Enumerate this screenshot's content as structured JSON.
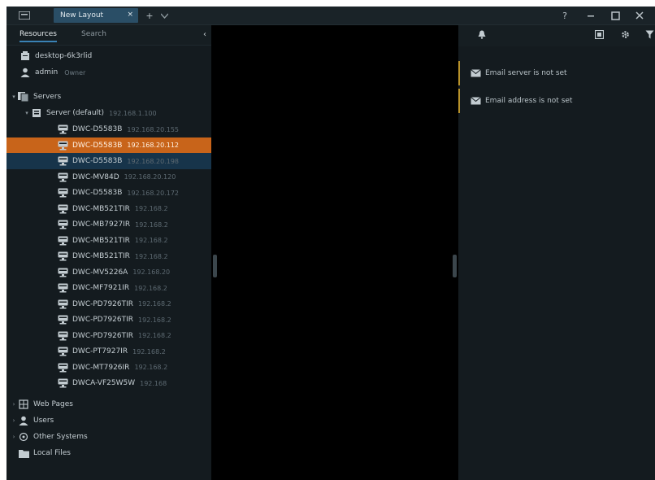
{
  "titlebar": {
    "tab_label": "New Layout",
    "tab_close": "×",
    "icons": [
      "menu-icon",
      "tab-close-icon",
      "add-tab-icon",
      "tab-list-icon",
      "help-icon",
      "minimize-icon",
      "maximize-icon",
      "close-icon"
    ]
  },
  "left_panel": {
    "tab_resources": "Resources",
    "tab_search": "Search",
    "collapse": "‹",
    "server_name": "desktop-6k3rlid",
    "user_name": "admin",
    "user_role": "Owner",
    "servers_group": "Servers",
    "server_node": {
      "label": "Server (default)",
      "ip": "192.168.1.100"
    },
    "cameras": [
      {
        "label": "DWC-D5583B",
        "ip": "192.168.20.155"
      },
      {
        "label": "DWC-D5583B",
        "ip": "192.168.20.112"
      },
      {
        "label": "DWC-D5583B",
        "ip": "192.168.20.198"
      },
      {
        "label": "DWC-MV84D",
        "ip": "192.168.20.120"
      },
      {
        "label": "DWC-D5583B",
        "ip": "192.168.20.172"
      },
      {
        "label": "DWC-MB521TIR",
        "ip": "192.168.2"
      },
      {
        "label": "DWC-MB7927IR",
        "ip": "192.168.2"
      },
      {
        "label": "DWC-MB521TIR",
        "ip": "192.168.2"
      },
      {
        "label": "DWC-MB521TIR",
        "ip": "192.168.2"
      },
      {
        "label": "DWC-MV5226A",
        "ip": "192.168.20"
      },
      {
        "label": "DWC-MF7921IR",
        "ip": "192.168.2"
      },
      {
        "label": "DWC-PD7926TIR",
        "ip": "192.168.2"
      },
      {
        "label": "DWC-PD7926TIR",
        "ip": "192.168.2"
      },
      {
        "label": "DWC-PD7926TIR",
        "ip": "192.168.2"
      },
      {
        "label": "DWC-PT7927IR",
        "ip": "192.168.2"
      },
      {
        "label": "DWC-MT7926IR",
        "ip": "192.168.2"
      },
      {
        "label": "DWCA-VF25W5W",
        "ip": "192.168"
      }
    ],
    "web_pages": "Web Pages",
    "users": "Users",
    "other_systems": "Other Systems",
    "local_files": "Local Files"
  },
  "right_panel": {
    "icons": [
      "notifications-icon",
      "video-wall-icon",
      "settings-icon",
      "filter-icon"
    ],
    "notifications": [
      "Email server is not set",
      "Email address is not set"
    ]
  },
  "colors": {
    "selected_row": "#c8641a",
    "active_tab": "#2a4e66",
    "notification_accent": "#b8922a"
  }
}
